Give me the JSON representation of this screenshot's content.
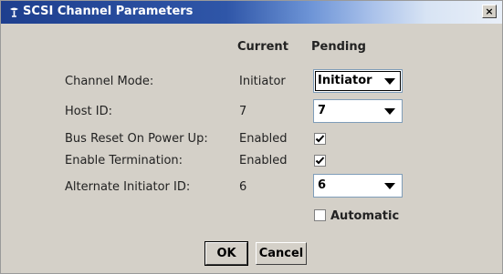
{
  "window": {
    "title": "SCSI Channel Parameters",
    "close_label": "×"
  },
  "headers": {
    "current": "Current",
    "pending": "Pending"
  },
  "rows": [
    {
      "label": "Channel Mode:",
      "current": "Initiator",
      "pending": "Initiator"
    },
    {
      "label": "Host ID:",
      "current": "7",
      "pending": "7"
    },
    {
      "label": "Bus Reset On Power Up:",
      "current": "Enabled",
      "pending_checked": true
    },
    {
      "label": "Enable Termination:",
      "current": "Enabled",
      "pending_checked": true
    },
    {
      "label": "Alternate Initiator ID:",
      "current": "6",
      "pending": "6"
    }
  ],
  "automatic": {
    "label": "Automatic",
    "checked": false
  },
  "buttons": {
    "ok": "OK",
    "cancel": "Cancel"
  }
}
